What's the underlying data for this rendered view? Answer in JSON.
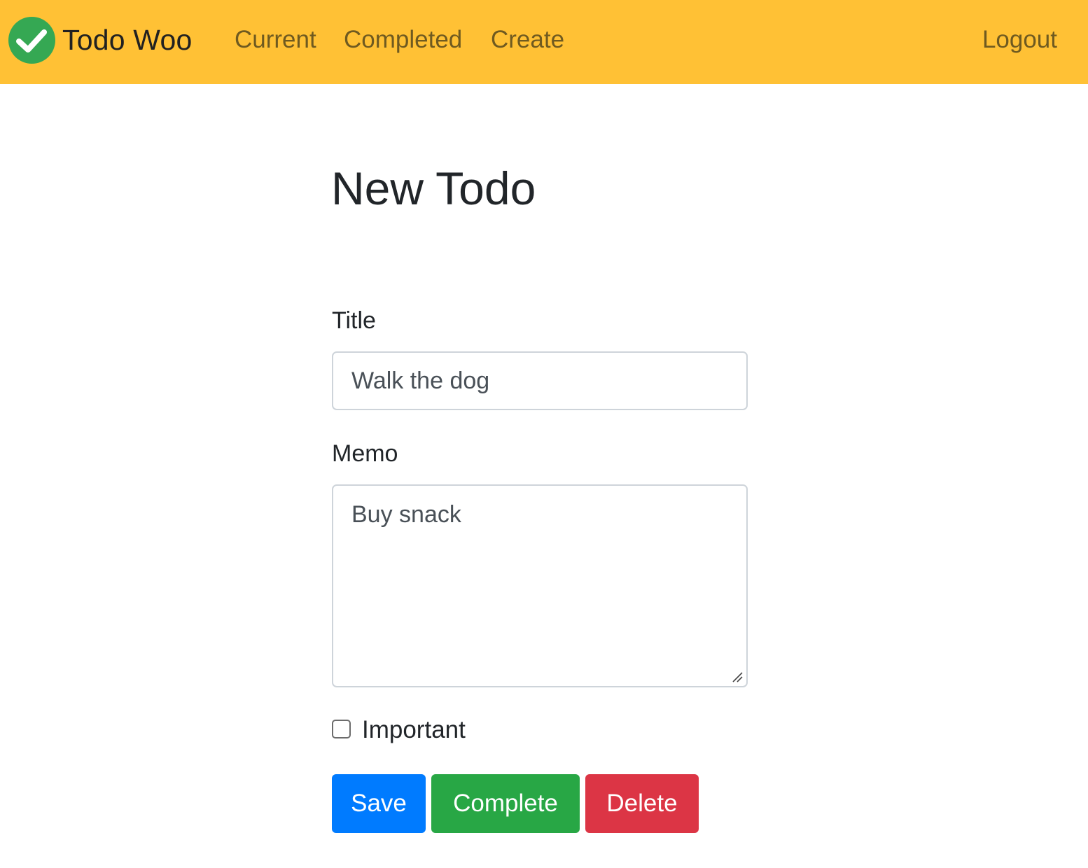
{
  "navbar": {
    "brand": "Todo Woo",
    "links": {
      "current": "Current",
      "completed": "Completed",
      "create": "Create",
      "logout": "Logout"
    }
  },
  "form": {
    "heading": "New Todo",
    "title_label": "Title",
    "title_value": "Walk the dog",
    "memo_label": "Memo",
    "memo_value": "Buy snack",
    "important_label": "Important",
    "important_checked": false
  },
  "buttons": {
    "save": "Save",
    "complete": "Complete",
    "delete": "Delete"
  },
  "colors": {
    "navbar_bg": "#ffc135",
    "nav_link": "#6f5a20",
    "logo_green": "#35a853",
    "save": "#007bff",
    "complete": "#28a745",
    "delete": "#dc3545"
  },
  "icons": {
    "brand_logo": "check-circle-icon",
    "textarea_resize": "resize-grip-icon"
  }
}
